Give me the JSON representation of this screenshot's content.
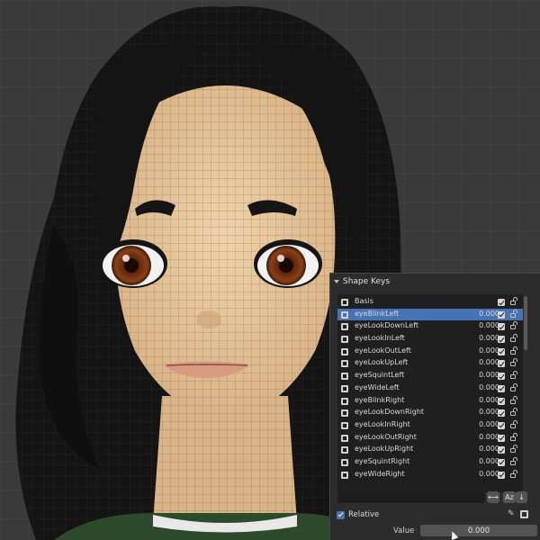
{
  "panel": {
    "title": "Shape Keys",
    "shape_keys": [
      {
        "name": "Basis",
        "value": "",
        "active": false
      },
      {
        "name": "eyeBlinkLeft",
        "value": "0.000",
        "active": true
      },
      {
        "name": "eyeLookDownLeft",
        "value": "0.000",
        "active": false
      },
      {
        "name": "eyeLookInLeft",
        "value": "0.000",
        "active": false
      },
      {
        "name": "eyeLookOutLeft",
        "value": "0.000",
        "active": false
      },
      {
        "name": "eyeLookUpLeft",
        "value": "0.000",
        "active": false
      },
      {
        "name": "eyeSquintLeft",
        "value": "0.000",
        "active": false
      },
      {
        "name": "eyeWideLeft",
        "value": "0.000",
        "active": false
      },
      {
        "name": "eyeBlinkRight",
        "value": "0.000",
        "active": false
      },
      {
        "name": "eyeLookDownRight",
        "value": "0.000",
        "active": false
      },
      {
        "name": "eyeLookInRight",
        "value": "0.000",
        "active": false
      },
      {
        "name": "eyeLookOutRight",
        "value": "0.000",
        "active": false
      },
      {
        "name": "eyeLookUpRight",
        "value": "0.000",
        "active": false
      },
      {
        "name": "eyeSquintRight",
        "value": "0.000",
        "active": false
      },
      {
        "name": "eyeWideRight",
        "value": "0.000",
        "active": false
      }
    ],
    "filter_placeholder": "",
    "swap_label": "⟷",
    "sort_label": "Az",
    "order_label": "↓",
    "relative_label": "Relative",
    "relative_checked": true,
    "value_label": "Value",
    "value": "0.000"
  },
  "colors": {
    "viewport_bg": "#3a3a3a",
    "panel_bg": "#2c2c2c",
    "selection": "#4772b3",
    "skin": "#e8c79b",
    "hair": "#141414",
    "iris": "#7a3413"
  }
}
